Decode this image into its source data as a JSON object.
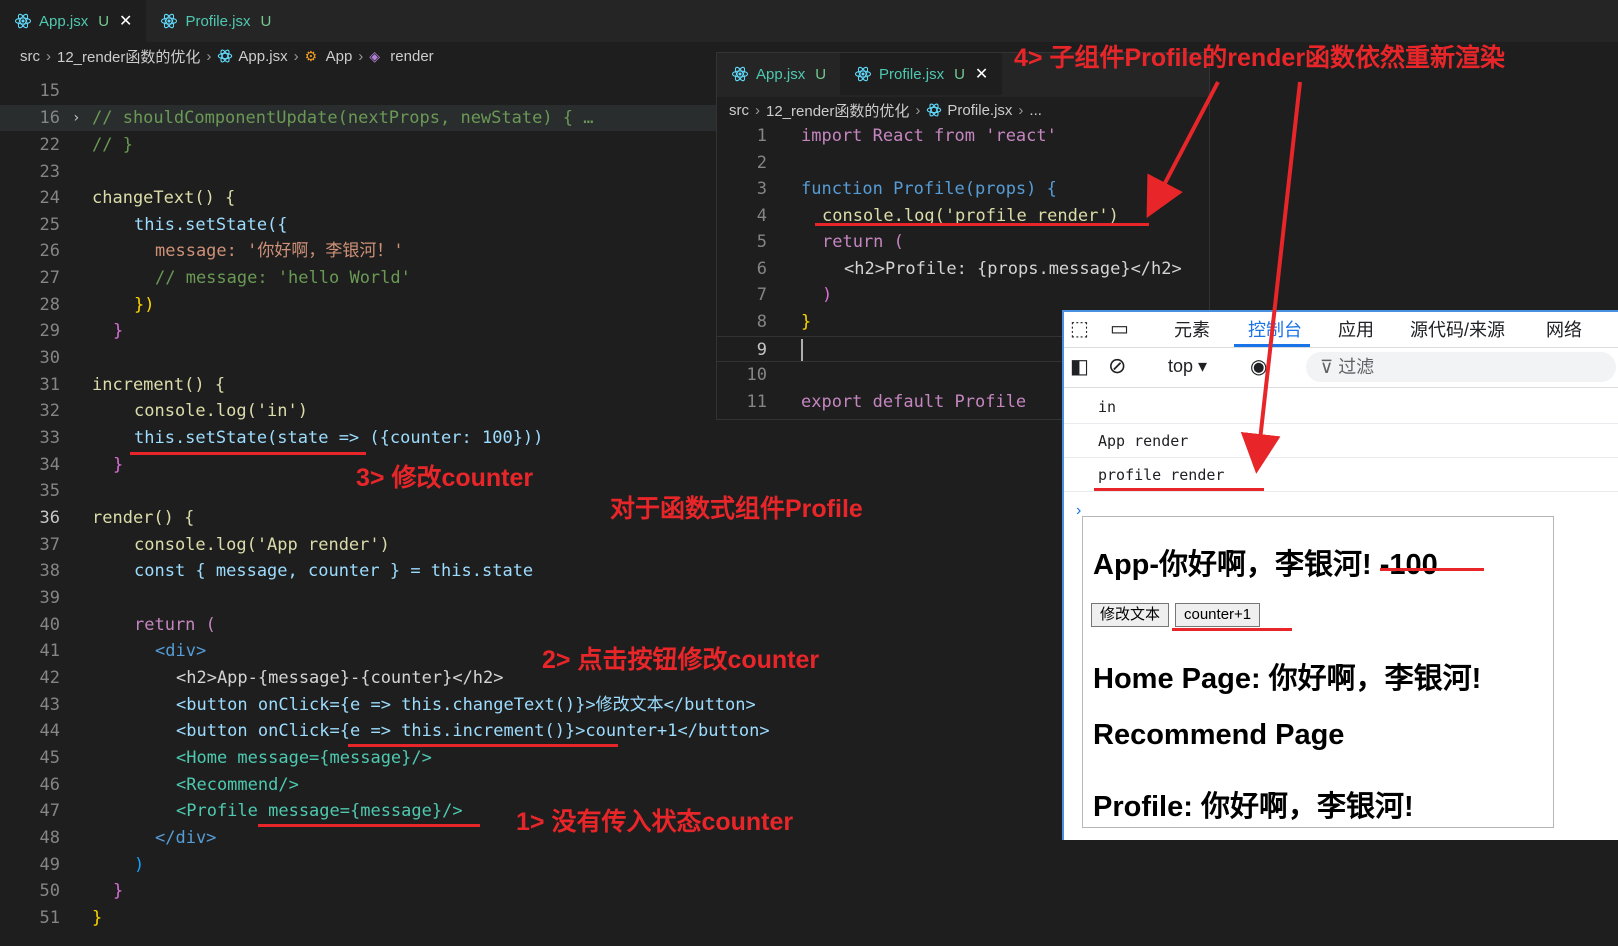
{
  "tabs": [
    {
      "label": "App.jsx",
      "status": "U",
      "active": true
    },
    {
      "label": "Profile.jsx",
      "status": "U",
      "active": false
    }
  ],
  "breadcrumb": [
    "src",
    "12_render函数的优化",
    "App.jsx",
    "App",
    "render"
  ],
  "main_lines": [
    {
      "n": "15",
      "t": ""
    },
    {
      "n": "16",
      "t": "// shouldComponentUpdate(nextProps, newState) { …"
    },
    {
      "n": "22",
      "t": "// }"
    },
    {
      "n": "23",
      "t": ""
    },
    {
      "n": "24",
      "t": "changeText() {"
    },
    {
      "n": "25",
      "t": "this.setState({"
    },
    {
      "n": "26",
      "t": "message: '你好啊，李银河！'"
    },
    {
      "n": "27",
      "t": "// message: 'hello World'"
    },
    {
      "n": "28",
      "t": "})"
    },
    {
      "n": "29",
      "t": "}"
    },
    {
      "n": "30",
      "t": ""
    },
    {
      "n": "31",
      "t": "increment() {"
    },
    {
      "n": "32",
      "t": "console.log('in')"
    },
    {
      "n": "33",
      "t": "this.setState(state => ({counter: 100}))"
    },
    {
      "n": "34",
      "t": "}"
    },
    {
      "n": "35",
      "t": ""
    },
    {
      "n": "36",
      "t": "render() {"
    },
    {
      "n": "37",
      "t": "console.log('App render')"
    },
    {
      "n": "38",
      "t": "const { message, counter } = this.state"
    },
    {
      "n": "39",
      "t": ""
    },
    {
      "n": "40",
      "t": "return ("
    },
    {
      "n": "41",
      "t": "<div>"
    },
    {
      "n": "42",
      "t": "<h2>App-{message}-{counter}</h2>"
    },
    {
      "n": "43",
      "t": "<button onClick={e => this.changeText()}>修改文本</button>"
    },
    {
      "n": "44",
      "t": "<button onClick={e => this.increment()}>counter+1</button>"
    },
    {
      "n": "45",
      "t": "<Home message={message}/>"
    },
    {
      "n": "46",
      "t": "<Recommend/>"
    },
    {
      "n": "47",
      "t": "<Profile message={message}/>"
    },
    {
      "n": "48",
      "t": "</div>"
    },
    {
      "n": "49",
      "t": ")"
    },
    {
      "n": "50",
      "t": "}"
    },
    {
      "n": "51",
      "t": "}"
    }
  ],
  "profile_editor": {
    "tabs": [
      {
        "label": "App.jsx",
        "status": "U"
      },
      {
        "label": "Profile.jsx",
        "status": "U"
      }
    ],
    "breadcrumb": [
      "src",
      "12_render函数的优化",
      "Profile.jsx",
      "..."
    ],
    "lines": [
      {
        "n": "1",
        "t": "import React from 'react'"
      },
      {
        "n": "2",
        "t": ""
      },
      {
        "n": "3",
        "t": "function Profile(props) {"
      },
      {
        "n": "4",
        "t": "console.log('profile render')"
      },
      {
        "n": "5",
        "t": "return ("
      },
      {
        "n": "6",
        "t": "<h2>Profile: {props.message}</h2>"
      },
      {
        "n": "7",
        "t": ")"
      },
      {
        "n": "8",
        "t": "}"
      },
      {
        "n": "9",
        "t": ""
      },
      {
        "n": "10",
        "t": ""
      },
      {
        "n": "11",
        "t": "export default Profile"
      }
    ]
  },
  "devtools": {
    "tabs": [
      "元素",
      "控制台",
      "应用",
      "源代码/来源",
      "网络"
    ],
    "active_tab": "控制台",
    "context": "top",
    "filter_placeholder": "过滤",
    "logs": [
      "in",
      "App render",
      "profile render"
    ],
    "prompt": "›"
  },
  "preview": {
    "heading": "App-你好啊，李银河! -100",
    "buttons": [
      "修改文本",
      "counter+1"
    ],
    "home": "Home Page: 你好啊，李银河!",
    "recommend": "Recommend Page",
    "profile": "Profile: 你好啊，李银河!"
  },
  "annotations": {
    "note1": "1> 没有传入状态counter",
    "note2": "2> 点击按钮修改counter",
    "note3": "3> 修改counter",
    "note4": "4> 子组件Profile的render函数依然重新渲染",
    "center": "对于函数式组件Profile"
  },
  "colors": {
    "annotation": "#e8262a",
    "accent": "#1a73e8",
    "editor_bg": "#1e1e1e"
  }
}
